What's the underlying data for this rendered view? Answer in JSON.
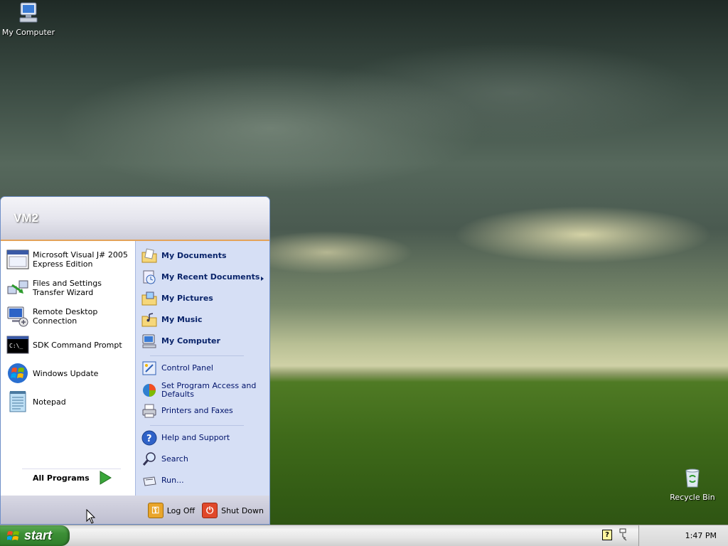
{
  "desktop": {
    "icons": [
      {
        "label": "My Computer"
      },
      {
        "label": "Recycle Bin"
      }
    ]
  },
  "start_menu": {
    "user_name": "VM2",
    "pinned_programs": [
      {
        "label": "Microsoft Visual J# 2005 Express Edition",
        "icon": "visual-jsharp-icon"
      },
      {
        "label": "Files and Settings Transfer Wizard",
        "icon": "transfer-wizard-icon"
      },
      {
        "label": "Remote Desktop Connection",
        "icon": "remote-desktop-icon"
      },
      {
        "label": "SDK Command Prompt",
        "icon": "command-prompt-icon"
      },
      {
        "label": "Windows Update",
        "icon": "windows-update-icon"
      },
      {
        "label": "Notepad",
        "icon": "notepad-icon"
      }
    ],
    "all_programs_label": "All Programs",
    "places": [
      {
        "label": "My Documents",
        "icon": "folder-documents-icon"
      },
      {
        "label": "My Recent Documents",
        "icon": "recent-documents-icon"
      },
      {
        "label": "My Pictures",
        "icon": "folder-pictures-icon"
      },
      {
        "label": "My Music",
        "icon": "folder-music-icon"
      },
      {
        "label": "My Computer",
        "icon": "computer-icon"
      }
    ],
    "settings": [
      {
        "label": "Control Panel",
        "icon": "control-panel-icon"
      },
      {
        "label": "Set Program Access and Defaults",
        "icon": "program-defaults-icon"
      },
      {
        "label": "Printers and Faxes",
        "icon": "printer-icon"
      }
    ],
    "tools": [
      {
        "label": "Help and Support",
        "icon": "help-icon"
      },
      {
        "label": "Search",
        "icon": "search-icon"
      },
      {
        "label": "Run...",
        "icon": "run-icon"
      }
    ],
    "footer": {
      "log_off_label": "Log Off",
      "shut_down_label": "Shut Down"
    }
  },
  "taskbar": {
    "start_label": "start",
    "clock": "1:47 PM"
  },
  "colors": {
    "start_button": "#3c8f36",
    "start_menu_header_border": "#e3a35a",
    "right_pane": "#d6dff5",
    "link_text": "#0a246a"
  }
}
